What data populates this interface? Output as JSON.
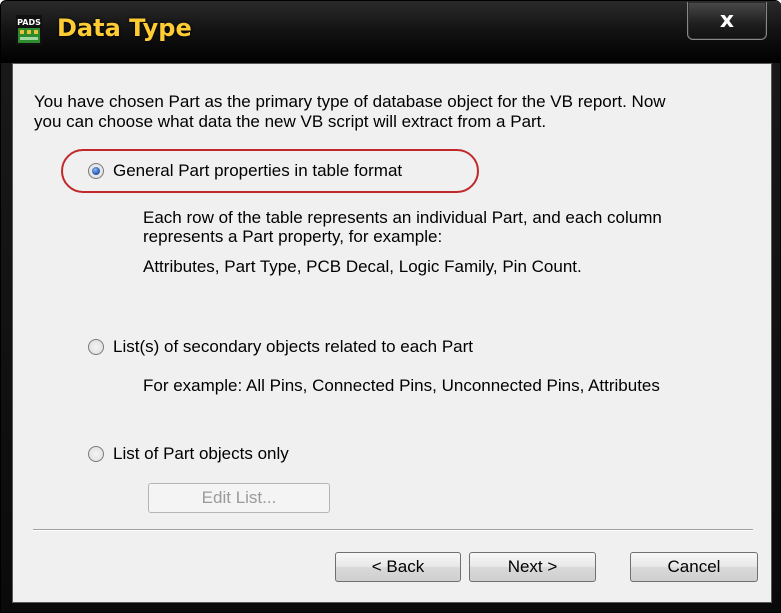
{
  "window": {
    "title": "Data Type",
    "app_icon_label": "PADS",
    "close_symbol": "x"
  },
  "intro": {
    "line1": "You have chosen Part as the primary type of database object for the VB report. Now",
    "line2": "you can choose what data the new VB script will extract from a Part."
  },
  "options": [
    {
      "label": "General Part properties in table format",
      "checked": true,
      "desc1": "Each row of the table represents an individual Part, and each column",
      "desc2": "represents a Part property, for example:",
      "desc3": "Attributes, Part Type, PCB Decal, Logic Family, Pin Count."
    },
    {
      "label": "List(s) of secondary objects related to each Part",
      "checked": false,
      "desc1": "For example: All Pins, Connected Pins, Unconnected Pins, Attributes"
    },
    {
      "label": "List of Part objects only",
      "checked": false
    }
  ],
  "edit_list_button": "Edit List...",
  "footer": {
    "back": "< Back",
    "next": "Next >",
    "cancel": "Cancel"
  },
  "colors": {
    "title_text": "#ffcc33",
    "highlight_ring": "#c0282a",
    "client_bg": "#f0f0f0"
  }
}
